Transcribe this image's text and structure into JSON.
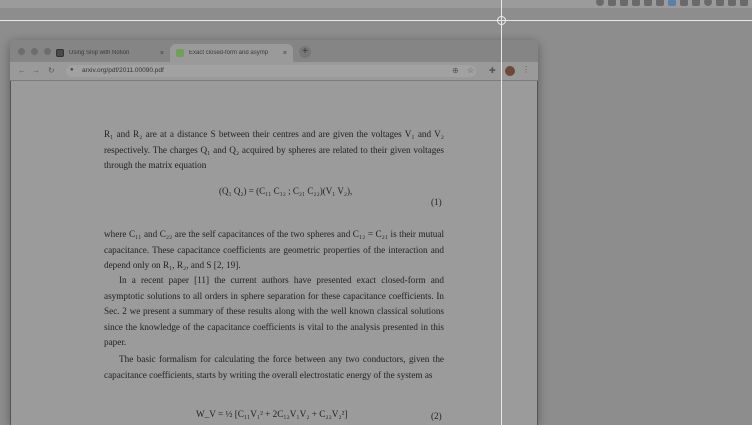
{
  "menubar": {
    "tray_icons": [
      "record-icon",
      "app-icon",
      "app-icon",
      "app-icon",
      "app-icon",
      "app-icon",
      "dropbox-icon",
      "app-icon",
      "app-icon",
      "app-icon",
      "app-icon",
      "app-icon",
      "wifi-icon"
    ]
  },
  "browser": {
    "tabs": [
      {
        "title": "Using Snip with Notion",
        "icon": "notion-icon"
      },
      {
        "title": "Exact closed-form and asymp",
        "icon": "arxiv-icon"
      }
    ],
    "new_tab": "+",
    "close": "×",
    "address": "arxiv.org/pdf/2011.00090.pdf",
    "nav": {
      "back": "←",
      "forward": "→",
      "reload": "↻"
    },
    "toolbar_icons": {
      "zoom": "⊕",
      "star": "☆",
      "extensions": "✚",
      "menu": "⋮"
    }
  },
  "pdf": {
    "para1": "R₁ and R₂ are at a distance S between their centres and are given the voltages V₁ and V₂ respectively. The charges Q₁ and Q₂ acquired by spheres are related to their given voltages through the matrix equation",
    "eq1": "(Q₁ Q₂) = (C₁₁ C₁₂ ; C₂₁ C₂₂)(V₁ V₂),",
    "eq1_number": "(1)",
    "para2": "where C₁₁ and C₂₂ are the self capacitances of the two spheres and C₁₂ = C₂₁ is their mutual capacitance. These capacitance coefficients are geometric properties of the interaction and depend only on R₁, R₂, and S [2, 19].",
    "para3": "In a recent paper [11] the current authors have presented exact closed-form and asymptotic solutions to all orders in sphere separation for these capacitance coefficients. In Sec. 2 we present a summary of these results along with the well known classical solutions since the knowledge of the capacitance coefficients is vital to the analysis presented in this paper.",
    "para4": "The basic formalism for calculating the force between any two conductors, given the capacitance coefficients, starts by writing the overall electrostatic energy of the system as",
    "eq2": "W_V = ½ [C₁₁V₁² + 2C₁₂V₁V₂ + C₂₂V₂²]",
    "eq2_number": "(2)"
  }
}
